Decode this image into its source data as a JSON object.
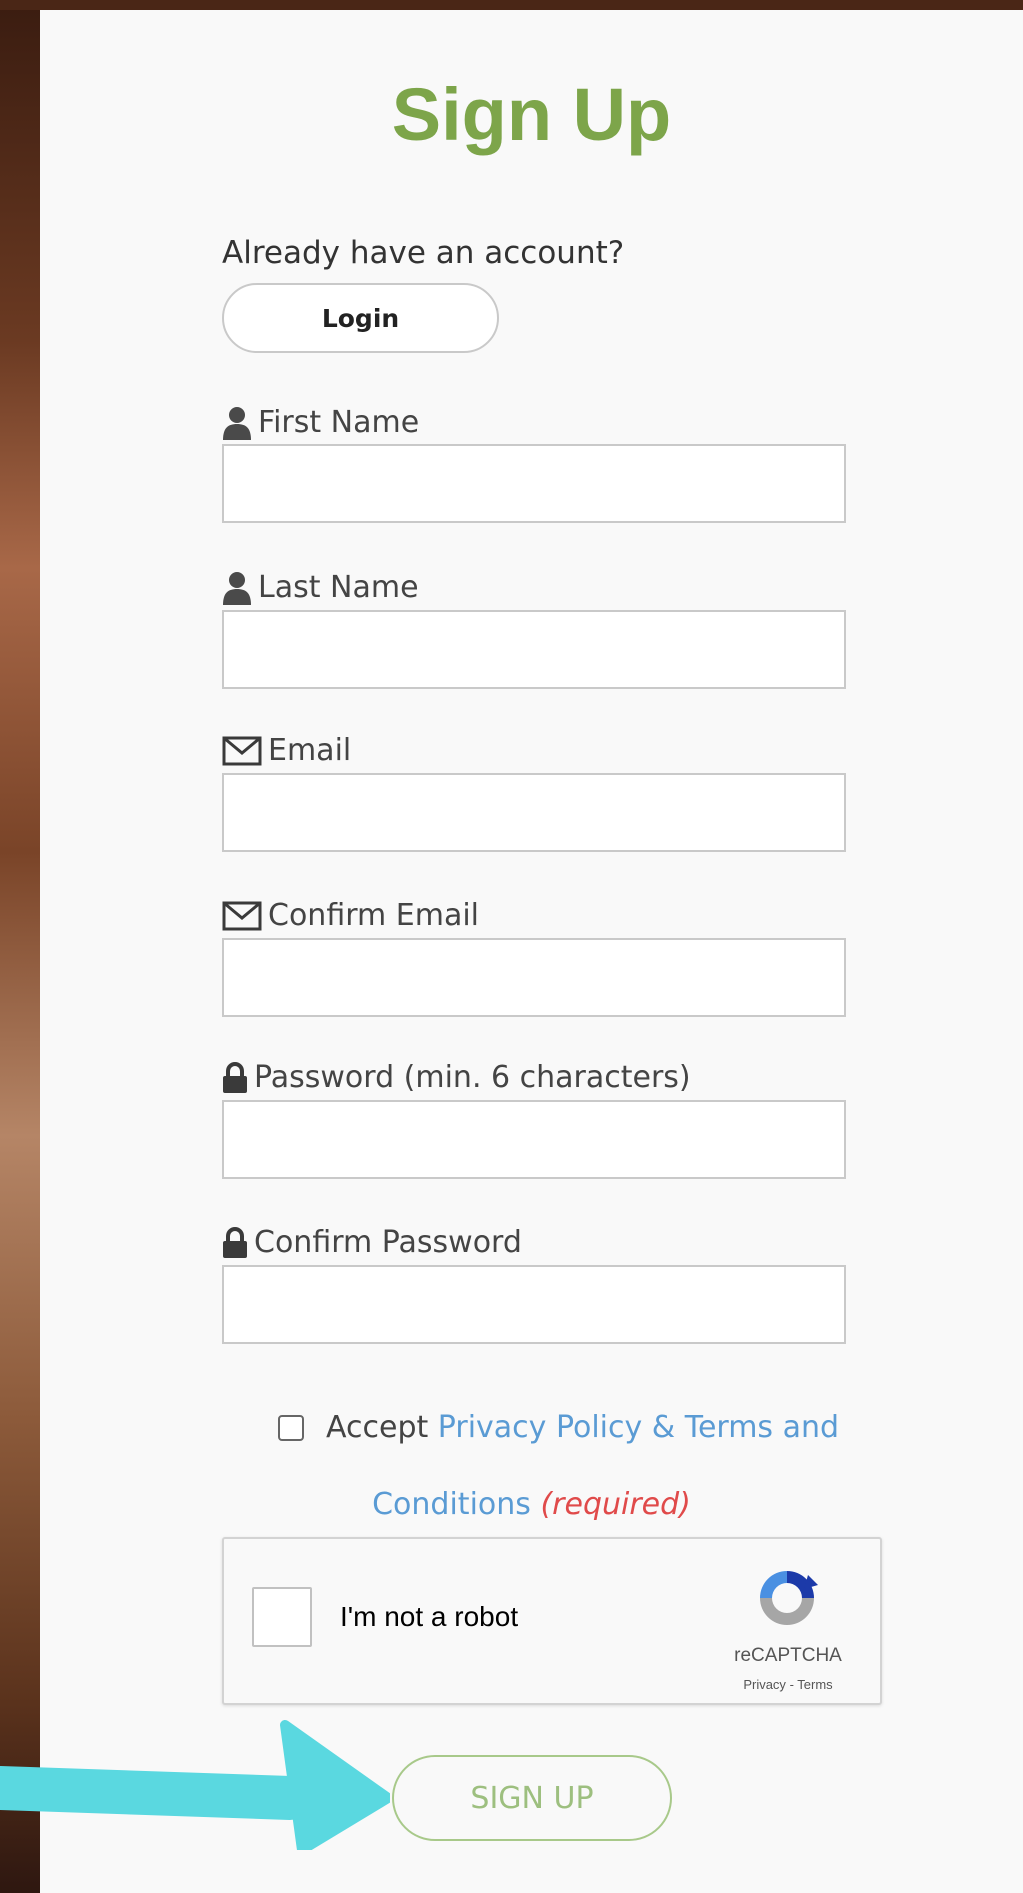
{
  "form": {
    "title": "Sign Up",
    "already_text": "Already have an account?",
    "login_label": "Login",
    "fields": [
      {
        "label": "First Name",
        "icon": "user-icon",
        "value": ""
      },
      {
        "label": "Last Name",
        "icon": "user-icon",
        "value": ""
      },
      {
        "label": "Email",
        "icon": "envelope-icon",
        "value": ""
      },
      {
        "label": "Confirm Email",
        "icon": "envelope-icon",
        "value": ""
      },
      {
        "label": "Password (min. 6 characters)",
        "icon": "lock-icon",
        "value": ""
      },
      {
        "label": "Confirm Password",
        "icon": "lock-icon",
        "value": ""
      }
    ],
    "accept": {
      "prefix": "Accept",
      "link_part1": "Privacy Policy & Terms and",
      "link_part2": "Conditions",
      "required": "(required)",
      "checked": false
    },
    "captcha": {
      "label": "I'm not a robot",
      "brand": "reCAPTCHA",
      "privacy": "Privacy",
      "separator": "-",
      "terms": "Terms",
      "checked": false
    },
    "submit_label": "SIGN UP"
  },
  "colors": {
    "title": "#7da54a",
    "link": "#5a9bd4",
    "required": "#e04a4a",
    "submit_border": "#a8c98a",
    "arrow": "#5ad8e0"
  }
}
